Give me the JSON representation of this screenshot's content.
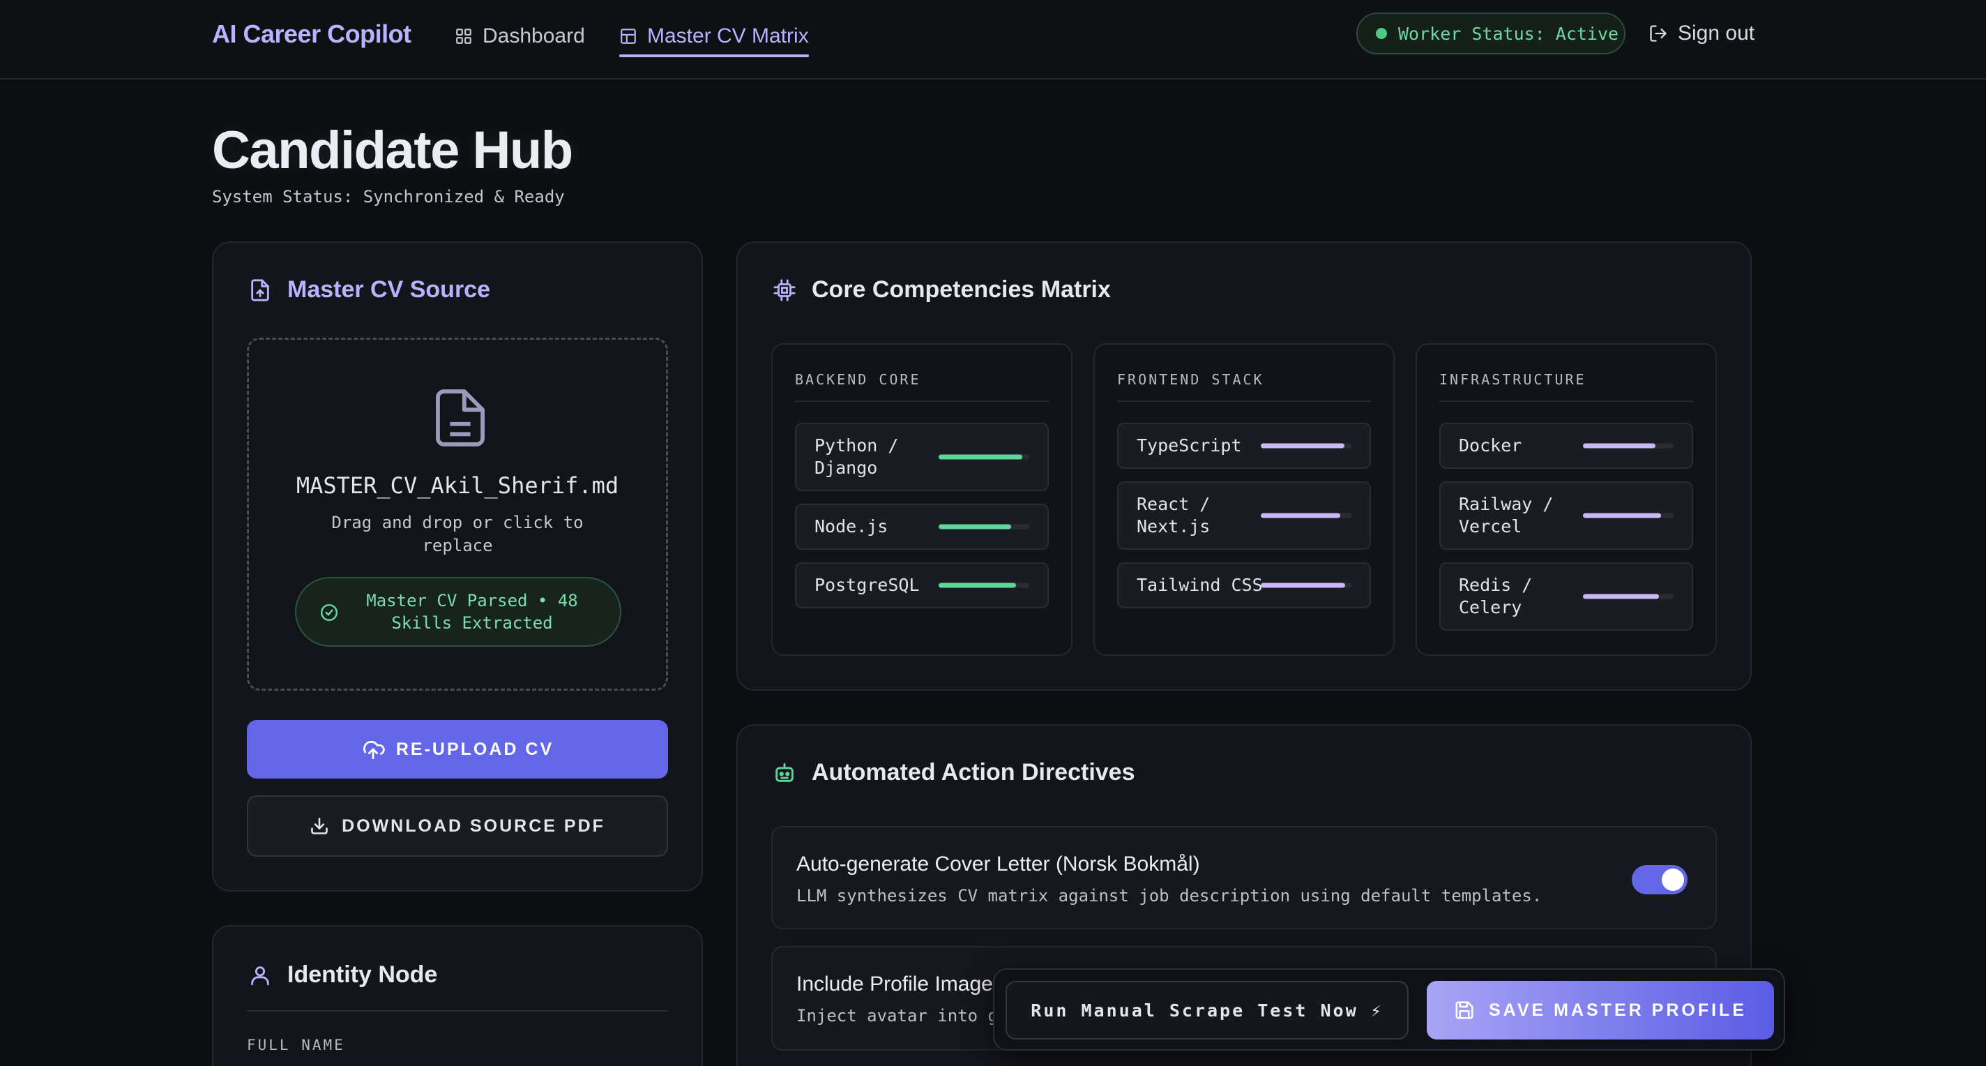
{
  "nav": {
    "brand": "AI Career Copilot",
    "links": [
      {
        "label": "Dashboard",
        "icon": "grid-icon",
        "active": false
      },
      {
        "label": "Master CV Matrix",
        "icon": "table-icon",
        "active": true
      }
    ],
    "worker_status": "Worker Status: Active",
    "sign_out": "Sign out"
  },
  "header": {
    "title": "Candidate Hub",
    "subtitle": "System Status: Synchronized & Ready"
  },
  "cv_source": {
    "title": "Master CV Source",
    "file_name": "MASTER_CV_Akil_Sherif.md",
    "hint": "Drag and drop or click to replace",
    "parsed_status": "Master CV Parsed • 48 Skills Extracted",
    "reupload_label": "RE-UPLOAD CV",
    "download_label": "DOWNLOAD SOURCE PDF"
  },
  "identity": {
    "title": "Identity Node",
    "full_name_label": "FULL NAME"
  },
  "competencies": {
    "title": "Core Competencies Matrix",
    "columns": [
      {
        "heading": "BACKEND CORE",
        "skills": [
          {
            "name": "Python / Django",
            "level": 0.92
          },
          {
            "name": "Node.js",
            "level": 0.8
          },
          {
            "name": "PostgreSQL",
            "level": 0.85
          }
        ]
      },
      {
        "heading": "FRONTEND STACK",
        "skills": [
          {
            "name": "TypeScript",
            "level": 0.92
          },
          {
            "name": "React / Next.js",
            "level": 0.88
          },
          {
            "name": "Tailwind CSS",
            "level": 0.93
          }
        ]
      },
      {
        "heading": "INFRASTRUCTURE",
        "skills": [
          {
            "name": "Docker",
            "level": 0.8
          },
          {
            "name": "Railway / Vercel",
            "level": 0.86
          },
          {
            "name": "Redis / Celery",
            "level": 0.84
          }
        ]
      }
    ]
  },
  "directives": {
    "title": "Automated Action Directives",
    "items": [
      {
        "title": "Auto-generate Cover Letter (Norsk Bokmål)",
        "description": "LLM synthesizes CV matrix against job description using default templates.",
        "enabled": true
      },
      {
        "title": "Include Profile Image",
        "description": "Inject avatar into g",
        "enabled": true
      }
    ]
  },
  "actions": {
    "scrape_label": "Run Manual Scrape Test Now ⚡",
    "save_label": "SAVE MASTER PROFILE"
  },
  "colors": {
    "accent": "#6466e8",
    "accent_light": "#b6b3ff",
    "success": "#4fc88a",
    "backend_bar": "#5fd69a",
    "frontend_bar": "#c9b8f5",
    "infra_bar": "#c9b8f5"
  }
}
